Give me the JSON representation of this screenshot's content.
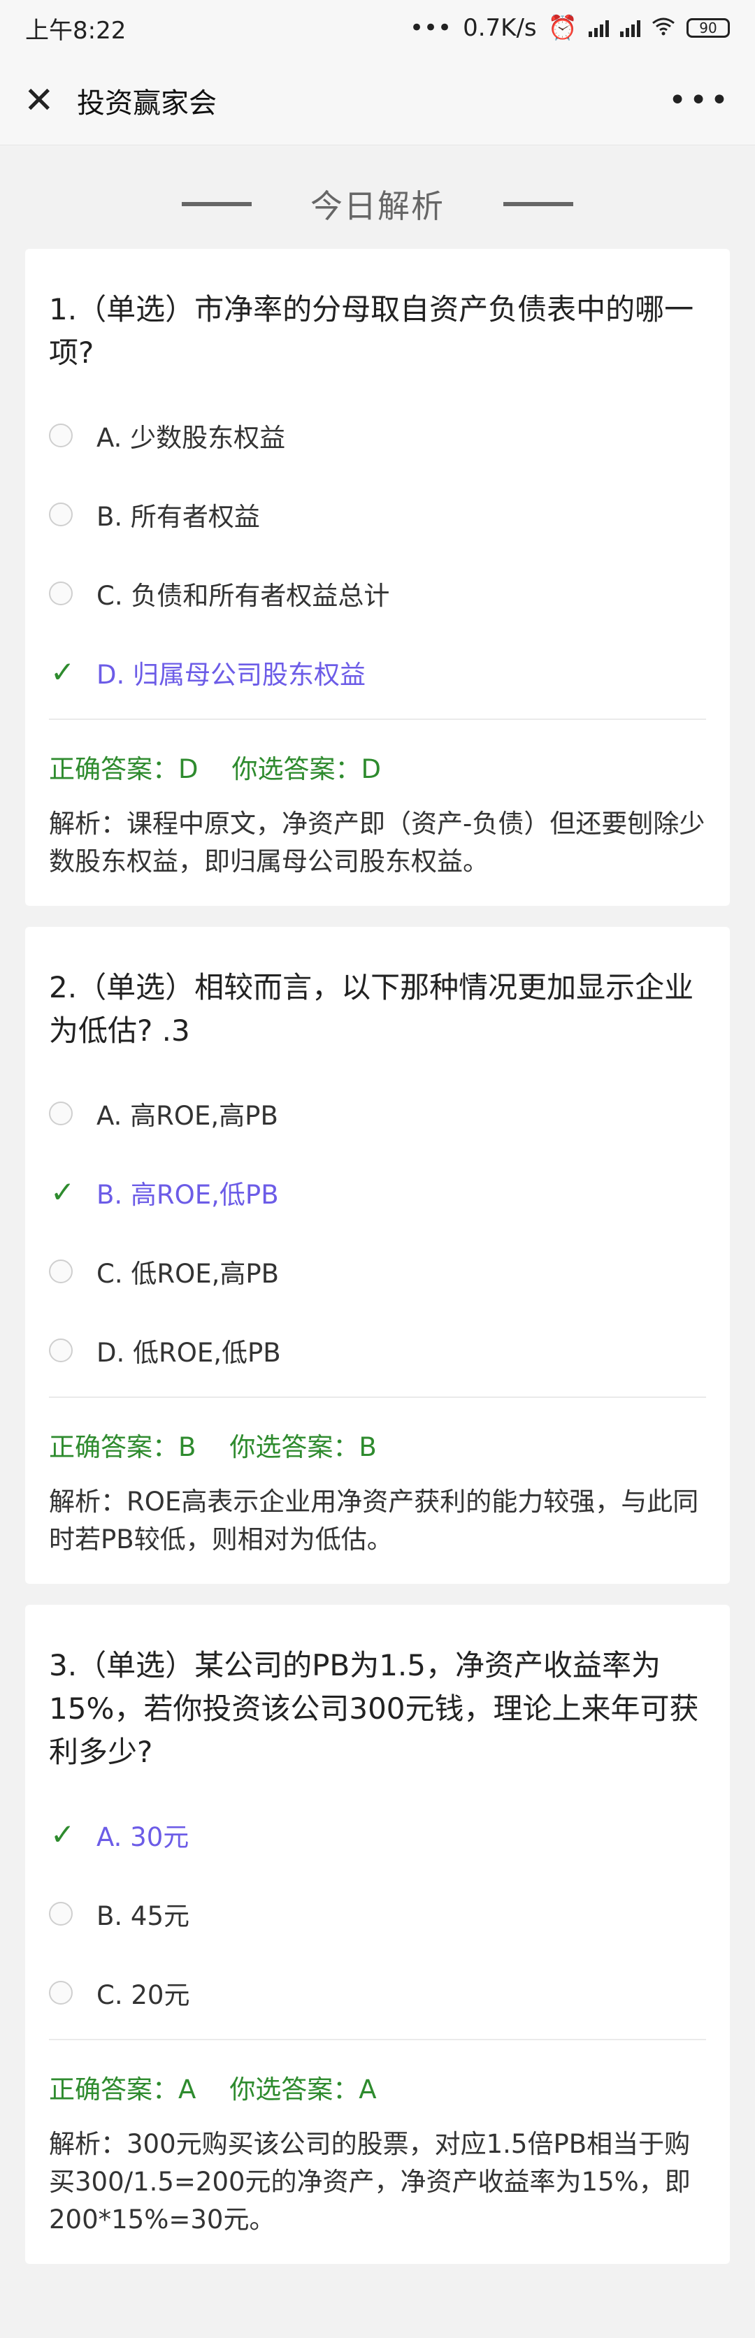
{
  "status": {
    "time": "上午8:22",
    "dots": "•••",
    "speed": "0.7K/s",
    "battery": "90"
  },
  "nav": {
    "title": "投资赢家会"
  },
  "heading": "今日解析",
  "questions": [
    {
      "question": "1.（单选）市净率的分母取自资产负债表中的哪一项?",
      "options": [
        {
          "label": "A. 少数股东权益",
          "state": "radio"
        },
        {
          "label": "B. 所有者权益",
          "state": "radio"
        },
        {
          "label": "C. 负债和所有者权益总计",
          "state": "radio"
        },
        {
          "label": "D. 归属母公司股东权益",
          "state": "correct"
        }
      ],
      "correct_answer": "正确答案：D",
      "your_answer": "你选答案：D",
      "explanation": "解析：课程中原文，净资产即（资产-负债）但还要刨除少数股东权益，即归属母公司股东权益。"
    },
    {
      "question": "2.（单选）相较而言，以下那种情况更加显示企业为低估? .3",
      "options": [
        {
          "label": "A. 高ROE,高PB",
          "state": "radio"
        },
        {
          "label": "B. 高ROE,低PB",
          "state": "correct"
        },
        {
          "label": "C. 低ROE,高PB",
          "state": "radio"
        },
        {
          "label": "D. 低ROE,低PB",
          "state": "radio"
        }
      ],
      "correct_answer": "正确答案：B",
      "your_answer": "你选答案：B",
      "explanation": "解析：ROE高表示企业用净资产获利的能力较强，与此同时若PB较低，则相对为低估。"
    },
    {
      "question": "3.（单选）某公司的PB为1.5，净资产收益率为15%，若你投资该公司300元钱，理论上来年可获利多少?",
      "options": [
        {
          "label": "A. 30元",
          "state": "correct"
        },
        {
          "label": "B. 45元",
          "state": "radio"
        },
        {
          "label": "C. 20元",
          "state": "radio"
        }
      ],
      "correct_answer": "正确答案：A",
      "your_answer": "你选答案：A",
      "explanation": "解析：300元购买该公司的股票，对应1.5倍PB相当于购买300/1.5=200元的净资产，净资产收益率为15%，即200*15%=30元。"
    }
  ],
  "colors": {
    "correct_green": "#2e8b2e",
    "selected_purple": "#6c5ce7",
    "background": "#f2f2f2"
  },
  "icons": [
    "close-icon",
    "more-icon",
    "check-icon",
    "radio-icon",
    "wifi-icon",
    "alarm-icon",
    "signal-icon",
    "battery-icon"
  ]
}
